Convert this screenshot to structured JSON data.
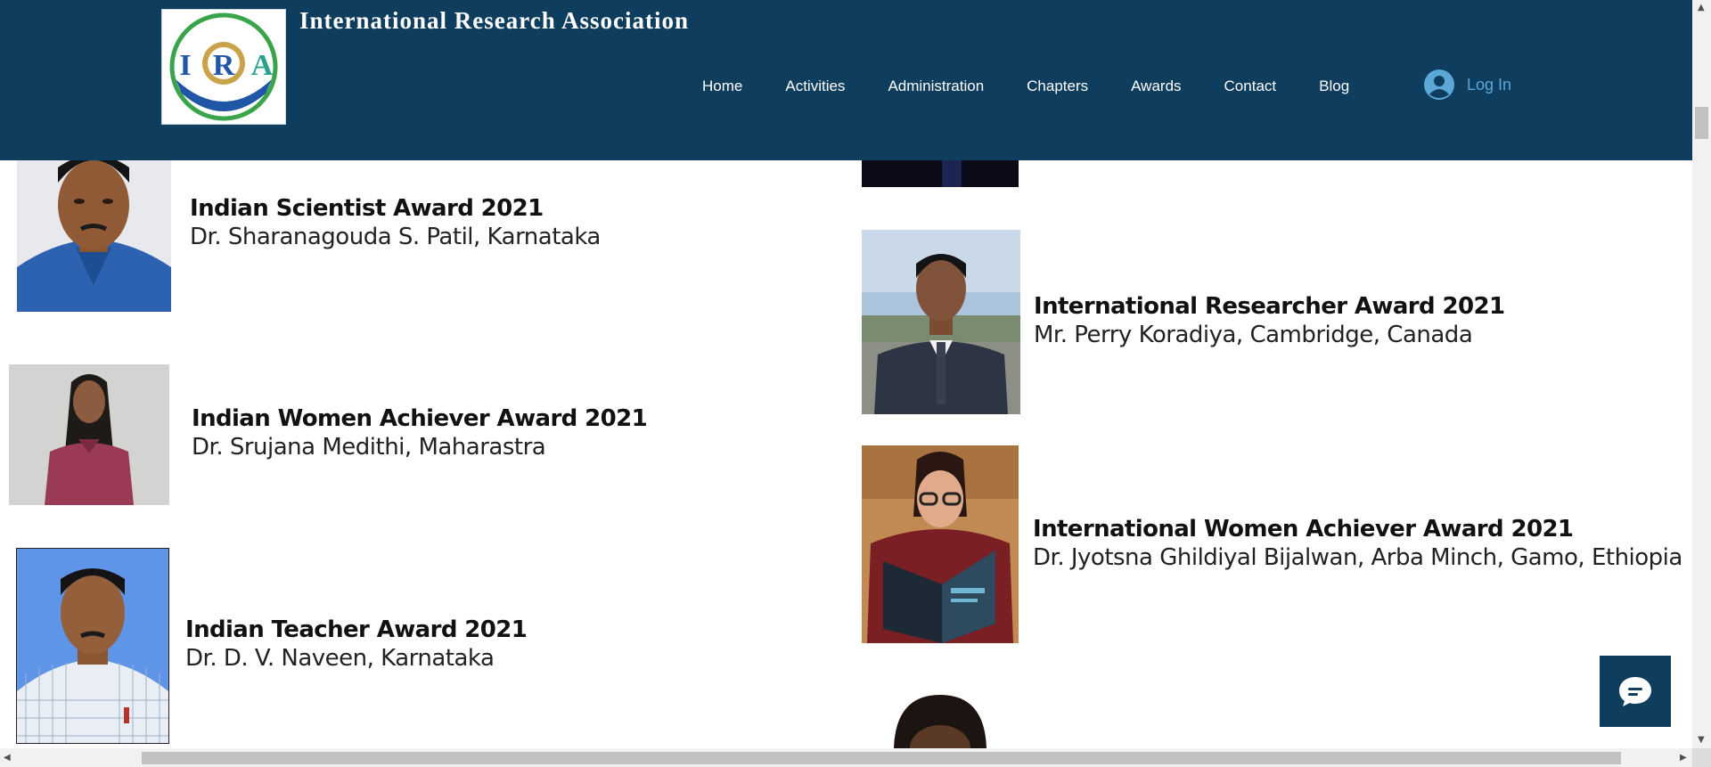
{
  "header": {
    "site_title": "International Research Association",
    "logo_letters": [
      "I",
      "R",
      "A"
    ],
    "background_color": "#0e3d5e"
  },
  "nav": {
    "items": [
      "Home",
      "Activities",
      "Administration",
      "Chapters",
      "Awards",
      "Contact",
      "Blog"
    ]
  },
  "login": {
    "label": "Log In",
    "icon": "user-avatar-icon"
  },
  "awards_left": [
    {
      "title": "Indian Scientist Award 2021",
      "name": "Dr. Sharanagouda S. Patil, Karnataka"
    },
    {
      "title": "Indian Women Achiever Award 2021",
      "name": "Dr. Srujana Medithi, Maharastra"
    },
    {
      "title": "Indian Teacher Award 2021",
      "name": "Dr. D. V. Naveen, Karnataka"
    }
  ],
  "awards_right": [
    {
      "title": "International Researcher Award 2021",
      "name": "Mr. Perry Koradiya, Cambridge, Canada"
    },
    {
      "title": "International Women Achiever Award 2021",
      "name": "Dr. Jyotsna Ghildiyal Bijalwan, Arba Minch, Gamo, Ethiopia"
    }
  ],
  "chat": {
    "icon": "chat-bubble-icon"
  },
  "colors": {
    "header": "#0e3d5e",
    "login_link": "#5aa7d8"
  }
}
